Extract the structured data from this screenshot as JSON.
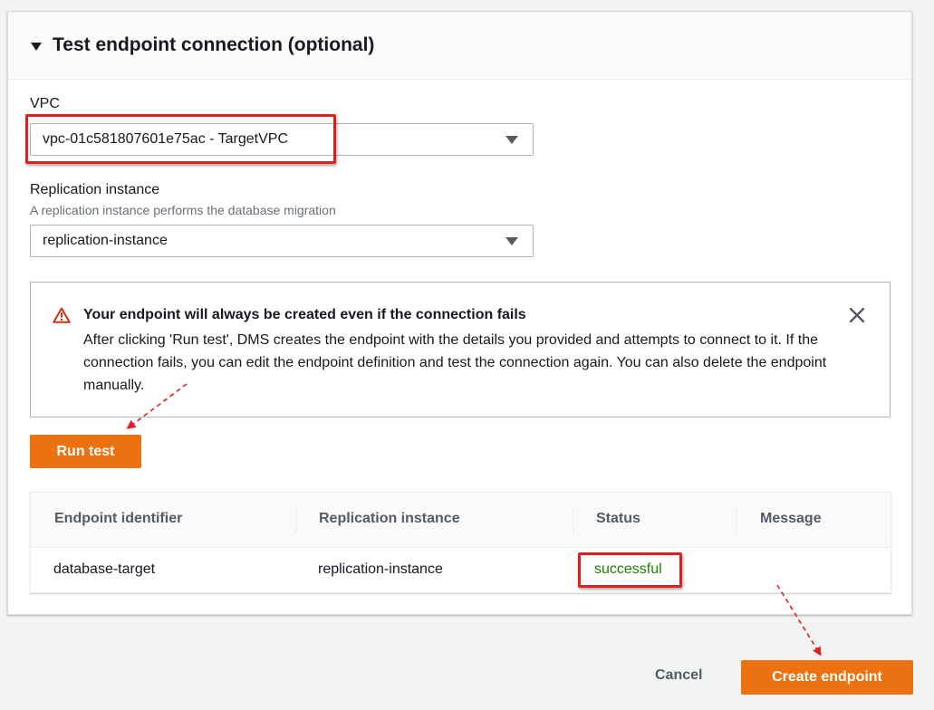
{
  "section": {
    "title": "Test endpoint connection (optional)"
  },
  "vpc": {
    "label": "VPC",
    "value": "vpc-01c581807601e75ac - TargetVPC"
  },
  "replication_instance": {
    "label": "Replication instance",
    "description": "A replication instance performs the database migration",
    "value": "replication-instance"
  },
  "alert": {
    "title": "Your endpoint will always be created even if the connection fails",
    "body": "After clicking 'Run test', DMS creates the endpoint with the details you provided and attempts to connect to it. If the connection fails, you can edit the endpoint definition and test the connection again. You can also delete the endpoint manually."
  },
  "run_test_label": "Run test",
  "table": {
    "headers": [
      "Endpoint identifier",
      "Replication instance",
      "Status",
      "Message"
    ],
    "rows": [
      {
        "endpoint": "database-target",
        "instance": "replication-instance",
        "status": "successful",
        "message": ""
      }
    ]
  },
  "footer": {
    "cancel_label": "Cancel",
    "create_label": "Create endpoint"
  },
  "colors": {
    "primary": "#ec7211",
    "success": "#1d8102",
    "annotation": "#e01e1e",
    "warning": "#d13212"
  }
}
